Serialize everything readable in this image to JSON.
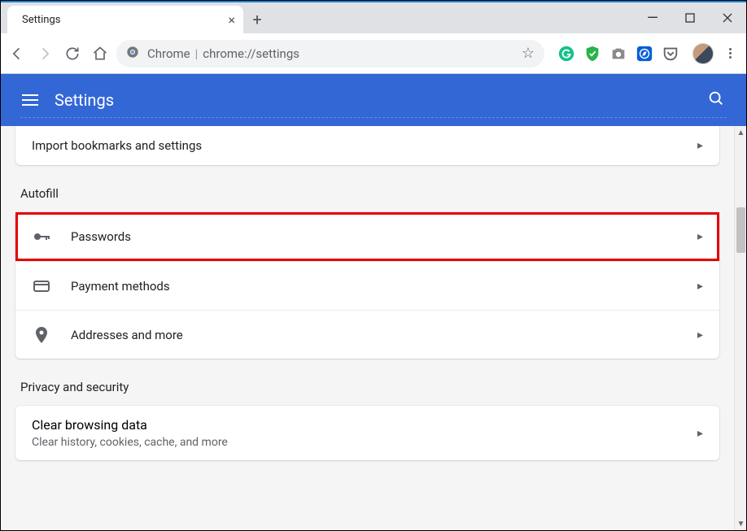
{
  "window": {
    "tab_title": "Settings"
  },
  "toolbar": {
    "omnibox_prefix": "Chrome",
    "omnibox_url": "chrome://settings"
  },
  "bluebar": {
    "title": "Settings"
  },
  "content": {
    "import_label": "Import bookmarks and settings",
    "autofill": {
      "title": "Autofill",
      "items": [
        {
          "label": "Passwords"
        },
        {
          "label": "Payment methods"
        },
        {
          "label": "Addresses and more"
        }
      ]
    },
    "privacy": {
      "title": "Privacy and security",
      "clear_title": "Clear browsing data",
      "clear_sub": "Clear history, cookies, cache, and more"
    }
  }
}
